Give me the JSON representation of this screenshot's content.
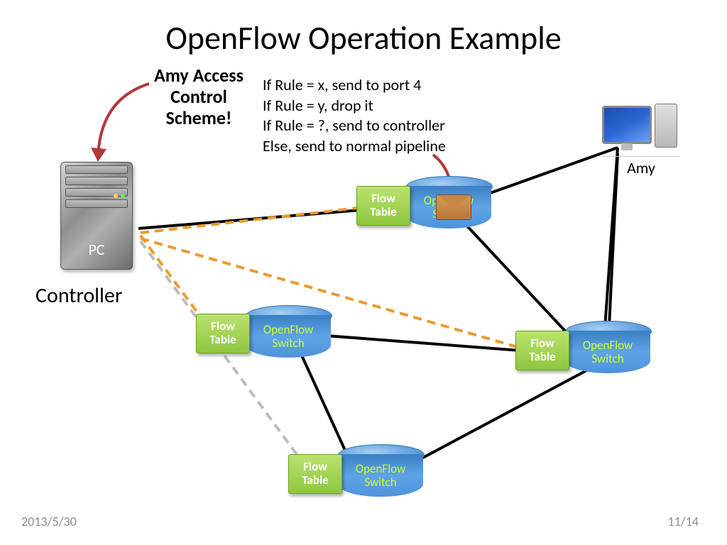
{
  "title": "OpenFlow Operation Example",
  "callout": "Amy Access Control Scheme!",
  "rules": {
    "r1": "If Rule = x, send to port 4",
    "r2": "If Rule = y, drop it",
    "r3": "If Rule = ?, send to controller",
    "r4": "Else, send to normal pipeline"
  },
  "controller": {
    "box_label": "PC",
    "caption": "Controller"
  },
  "amy": {
    "caption": "Amy"
  },
  "switch_label_top": "OpenFlow",
  "switch_label_bottom": "Switch",
  "flowtable_label_top": "Flow",
  "flowtable_label_bottom": "Table",
  "footer": {
    "date": "2013/5/30",
    "page": "11/14"
  }
}
